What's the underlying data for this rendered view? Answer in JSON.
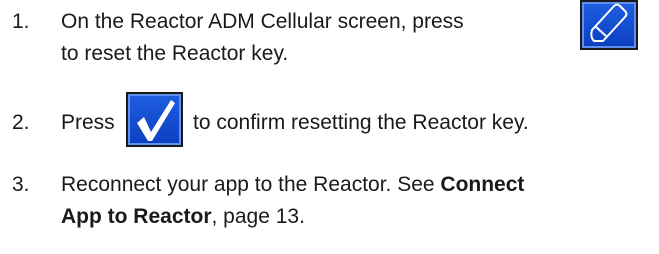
{
  "steps": [
    {
      "number": "1.",
      "line1": "On the Reactor ADM Cellular screen, press",
      "line2": "to reset the Reactor key.",
      "icon": "eraser-icon"
    },
    {
      "number": "2.",
      "before": "Press",
      "after": "to confirm resetting the Reactor key.",
      "icon": "checkmark-icon"
    },
    {
      "number": "3.",
      "line1_pre": "Reconnect your app to the Reactor. See ",
      "line1_bold": "Connect",
      "line2_bold": "App to Reactor",
      "line2_post": ", page 13."
    }
  ],
  "colors": {
    "button_blue": "#1f5fe0",
    "button_border": "#1a1a1a",
    "glyph_white": "#ffffff",
    "text": "#1a1a1a"
  }
}
